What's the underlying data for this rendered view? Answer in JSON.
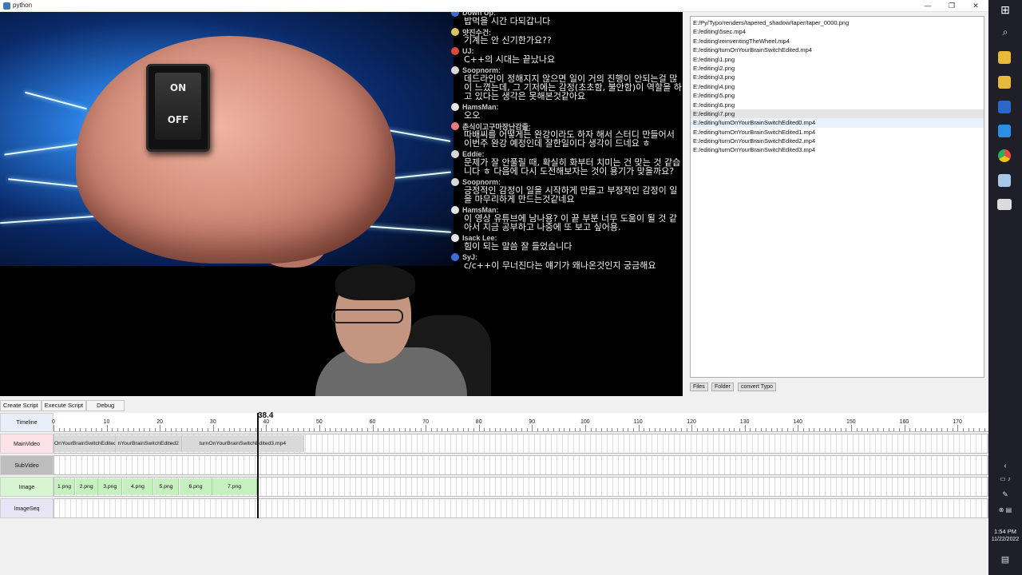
{
  "window": {
    "title": "python"
  },
  "video": {
    "switch_on": "ON",
    "switch_off": "OFF",
    "chat": [
      {
        "name": "Down Up:",
        "text": "밥먹을 시간 다되갑니다",
        "color": "#3a6fd8"
      },
      {
        "name": "얏진수건:",
        "text": "기계는 안 신기한가요??",
        "color": "#d8c65a"
      },
      {
        "name": "UJ:",
        "text": "C++의 시대는 끝났나요",
        "color": "#d84a3a"
      },
      {
        "name": "Soopnorm:",
        "text": "데드라인이 정해지지 않으면 일이 거의 진행이 안되는걸 많이 느꼈는데, 그 기저에는 감정(초초함, 불안함)이 역할을 하고 있다는 생각은 못해본것같아요",
        "color": "#d8d8d8"
      },
      {
        "name": "HamsMan:",
        "text": "오오",
        "color": "#e8e8e8"
      },
      {
        "name": "춘식이고구마장난감줄:",
        "text": "따배씨를 어떻게든 완강이라도 하자 해서 스터디 만들어서 이번주 완강 예정인데 잘한일이다 생각이 드네요 ㅎ",
        "color": "#e87b7b"
      },
      {
        "name": "Eddie:",
        "text": "문제가 잘 안풀릴 때, 확실히 화부터 치미는 건 맞는 것 같습니다 ㅎ 다음에 다시 도전해보자는 것이 용기가 맞을까요?",
        "color": "#d8d8d8"
      },
      {
        "name": "Soopnorm:",
        "text": "긍정적인 감정이 일을 시작하게 만들고 부정적인 감정이 일을 마무리하게 만드는것같네요",
        "color": "#d8d8d8"
      },
      {
        "name": "HamsMan:",
        "text": "이 영상 유튜브에 남나용? 이 끝 부분 너무 도움이 될 것 같아서 지금 공부하고 나중에 또 보고 싶어용.",
        "color": "#e8e8e8"
      },
      {
        "name": "Isack Lee:",
        "text": "힘이 되는 말씀 잘 들었습니다",
        "color": "#e8e8e8"
      },
      {
        "name": "SyJ:",
        "text": "c/c++이 무너진다는 얘기가 왜나온것인지 궁금해요",
        "color": "#3a6fd8"
      }
    ]
  },
  "files": [
    "E:/Py/Typo/renders/tapered_shadow/taper/taper_0000.png",
    "E:/editing\\5sec.mp4",
    "E:/editing\\reinventingTheWheel.mp4",
    "E:/editing/turnOnYourBrainSwitchEdited.mp4",
    "E:/editing\\1.png",
    "E:/editing\\2.png",
    "E:/editing\\3.png",
    "E:/editing\\4.png",
    "E:/editing\\5.png",
    "E:/editing\\6.png",
    "E:/editing\\7.png",
    "E:/editing/turnOnYourBrainSwitchEdited0.mp4",
    "E:/editing/turnOnYourBrainSwitchEdited1.mp4",
    "E:/editing/turnOnYourBrainSwitchEdited2.mp4",
    "E:/editing/turnOnYourBrainSwitchEdited3.mp4"
  ],
  "selected_file_index": 10,
  "hover_file_index": 11,
  "file_buttons": {
    "files": "Files",
    "folder": "Folder",
    "convert": "convert Typo"
  },
  "tabs": {
    "create": "Create Script",
    "execute": "Execute Script",
    "debug": "Debug"
  },
  "timeline": {
    "playhead": "38.4",
    "ticks": [
      "0",
      "10",
      "20",
      "30",
      "40",
      "50",
      "60",
      "70",
      "80",
      "90",
      "100",
      "110",
      "120",
      "130",
      "140",
      "150",
      "160",
      "170"
    ],
    "tracks": {
      "timeline": "Timeline",
      "main": "MainVideo",
      "sub": "SubVideo",
      "image": "Image",
      "imageseq": "ImageSeq"
    },
    "main_clips": [
      {
        "label": "OnYourBrainSwitchEdited",
        "start": 0,
        "end": 11.5
      },
      {
        "label": "nYourBrainSwitchEdited2",
        "start": 11.5,
        "end": 24
      },
      {
        "label": "turnOnYourBrainSwitchEdited3.mp4",
        "start": 24,
        "end": 47
      }
    ],
    "image_clips": [
      {
        "label": "1.png",
        "start": 0,
        "end": 3.9
      },
      {
        "label": "2.png",
        "start": 4,
        "end": 8.2
      },
      {
        "label": "3.png",
        "start": 8.3,
        "end": 12.8
      },
      {
        "label": "4.png",
        "start": 12.9,
        "end": 18.6
      },
      {
        "label": "5.png",
        "start": 18.7,
        "end": 23.5
      },
      {
        "label": "6.png",
        "start": 23.6,
        "end": 29.7
      },
      {
        "label": "7.png",
        "start": 29.8,
        "end": 38.1
      }
    ]
  },
  "taskbar": {
    "time": "1:54 PM",
    "date": "11/22/2022"
  }
}
